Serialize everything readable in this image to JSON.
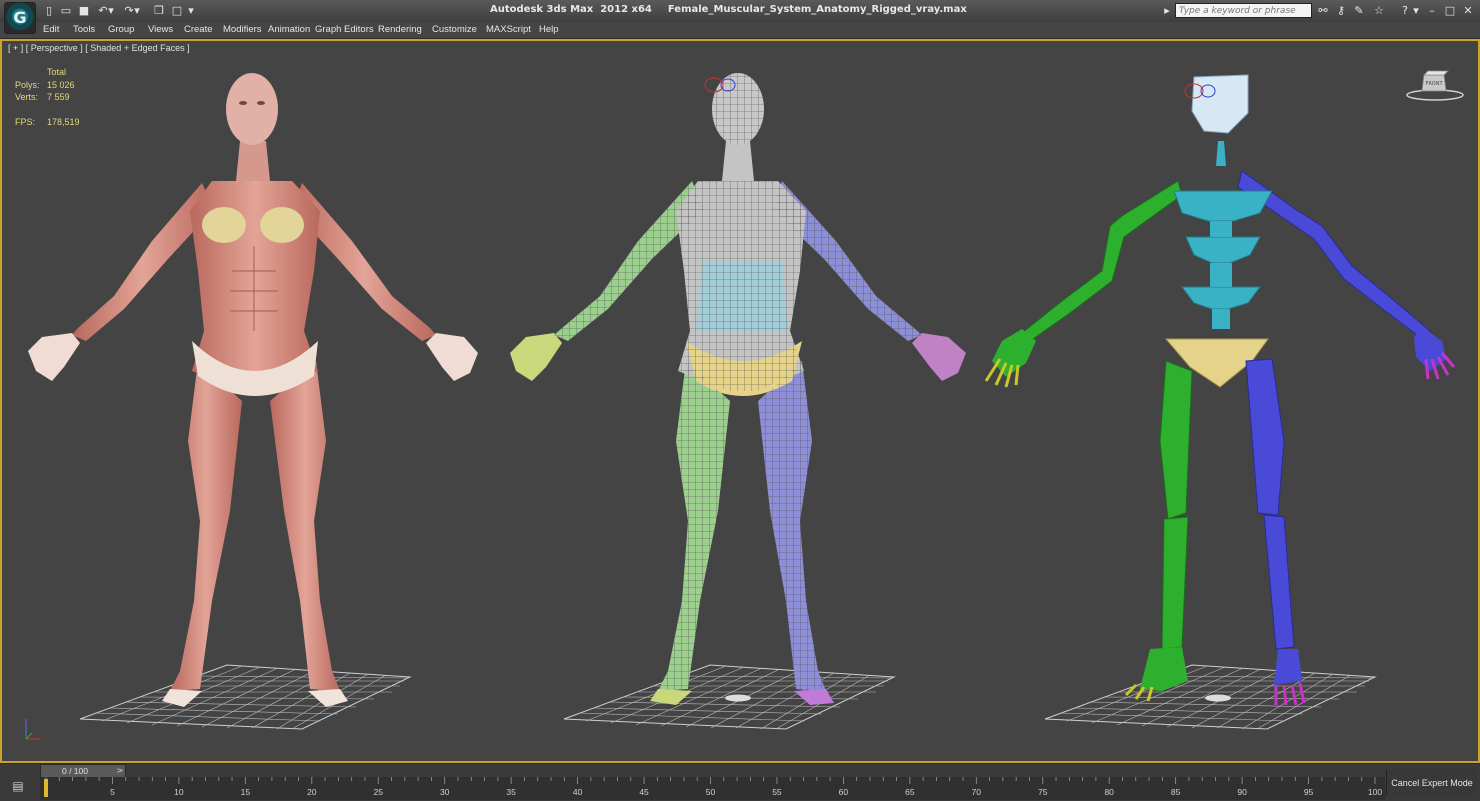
{
  "window": {
    "app_name": "Autodesk 3ds Max  2012 x64",
    "file_name": "Female_Muscular_System_Anatomy_Rigged_vray.max"
  },
  "search": {
    "placeholder": "Type a keyword or phrase"
  },
  "menu": [
    "Edit",
    "Tools",
    "Group",
    "Views",
    "Create",
    "Modifiers",
    "Animation",
    "Graph Editors",
    "Rendering",
    "Customize",
    "MAXScript",
    "Help"
  ],
  "viewport": {
    "label": "[ + ] [ Perspective ] [ Shaded + Edged Faces ]",
    "stats": {
      "header": "Total",
      "polys_label": "Polys:",
      "polys_value": "15 026",
      "verts_label": "Verts:",
      "verts_value": "7 559",
      "fps_label": "FPS:",
      "fps_value": "178,519"
    },
    "viewcube_label": "FRONT"
  },
  "timeline": {
    "slider_label": "0 / 100",
    "frames": [
      "0",
      "5",
      "10",
      "15",
      "20",
      "25",
      "30",
      "35",
      "40",
      "45",
      "50",
      "55",
      "60",
      "65",
      "70",
      "75",
      "80",
      "85",
      "90",
      "95",
      "100"
    ],
    "cancel_label": "Cancel Expert Mode"
  },
  "colors": {
    "viewport_bg": "#444444",
    "active_border": "#c8a528",
    "stats_text": "#e7d77a",
    "muscle": "#d8938a",
    "bone_left": "#2db02d",
    "bone_right": "#4a4ad8",
    "bone_spine": "#3ab2c6",
    "pelvis": "#e6d38a"
  },
  "icons": {
    "app": "3ds-max-logo",
    "quick_access": [
      "new-file-icon",
      "open-folder-icon",
      "save-icon",
      "undo-icon",
      "redo-icon",
      "project-folder-icon",
      "window-icon",
      "dropdown-icon"
    ],
    "infocenter": [
      "binoculars-icon",
      "key-icon",
      "tools-icon",
      "star-icon",
      "help-icon"
    ]
  }
}
